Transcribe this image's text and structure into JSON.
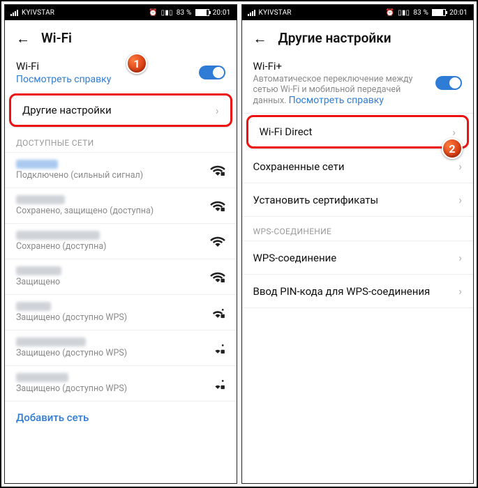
{
  "statusbar": {
    "carrier": "KYIVSTAR",
    "battery": "83 %",
    "time": "20:01"
  },
  "left": {
    "title": "Wi-Fi",
    "wifi_label": "Wi-Fi",
    "wifi_help": "Посмотреть справку",
    "more_settings": "Другие настройки",
    "section_available": "ДОСТУПНЫЕ СЕТИ",
    "networks": [
      {
        "status": "Подключено (сильный сигнал)"
      },
      {
        "status": "Сохранено, защищено (доступна)"
      },
      {
        "status": "Сохранено (доступна)"
      },
      {
        "status": "Защищено"
      },
      {
        "status": "Защищено (доступно WPS)"
      },
      {
        "status": "Защищено (доступно WPS)"
      },
      {
        "status": "Защищено (доступно WPS)"
      }
    ],
    "add_network": "Добавить сеть",
    "badge": "1"
  },
  "right": {
    "title": "Другие настройки",
    "wifi_plus_label": "Wi-Fi+",
    "wifi_plus_desc": "Автоматическое переключение между сетью Wi-Fi и мобильной передачей данных.",
    "wifi_plus_help": "Посмотреть справку",
    "wifi_direct": "Wi-Fi Direct",
    "saved_networks": "Сохраненные сети",
    "install_certs": "Установить сертификаты",
    "section_wps": "WPS-СОЕДИНЕНИЕ",
    "wps_conn": "WPS-соединение",
    "wps_pin": "Ввод PIN-кода для WPS-соединения",
    "badge": "2"
  }
}
